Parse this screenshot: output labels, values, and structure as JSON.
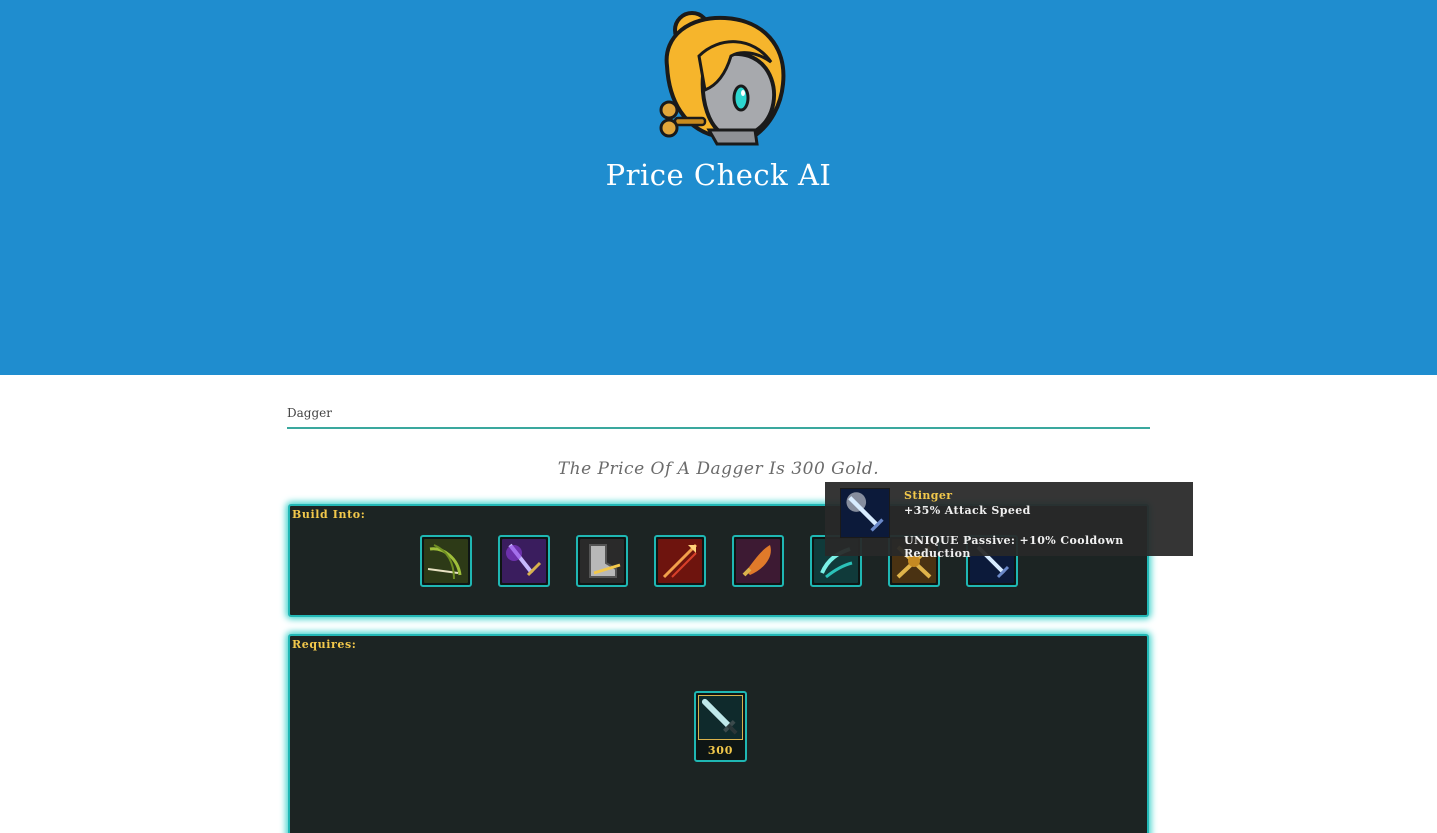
{
  "header": {
    "title": "Price Check AI",
    "logo_icon": "chibi-clockwork-girl-logo",
    "background": "#1f8dcf"
  },
  "search": {
    "value": "Dagger",
    "placeholder": ""
  },
  "answer": {
    "text": "The Price Of A Dagger Is 300 Gold."
  },
  "build_into": {
    "label": "Build Into:",
    "items": [
      {
        "icon": "recurve-bow-icon"
      },
      {
        "icon": "purple-sword-icon"
      },
      {
        "icon": "armored-boots-icon"
      },
      {
        "icon": "red-spear-icon"
      },
      {
        "icon": "flame-dagger-icon"
      },
      {
        "icon": "teal-claw-icon"
      },
      {
        "icon": "golden-crossbow-icon"
      },
      {
        "icon": "stinger-icon"
      }
    ]
  },
  "requires": {
    "label": "Requires:",
    "items": [
      {
        "icon": "dagger-icon",
        "price": "300"
      }
    ]
  },
  "tooltip": {
    "name": "Stinger",
    "stat": "+35% Attack Speed",
    "passive": "UNIQUE Passive: +10% Cooldown Reduction"
  },
  "colors": {
    "panel_bg": "#1c2423",
    "panel_border": "#22b7b5",
    "gold_text": "#f2c84b"
  }
}
